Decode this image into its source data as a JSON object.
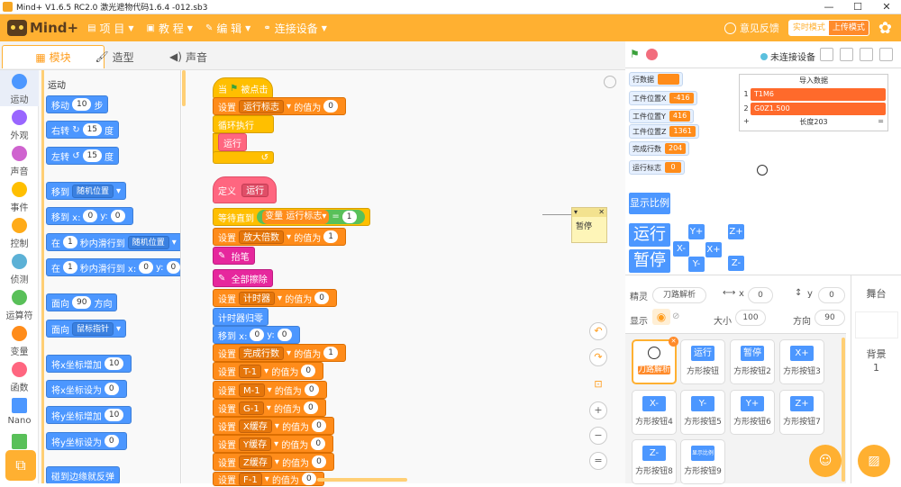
{
  "window": {
    "title": "Mind+ V1.6.5 RC2.0   激光遮物代码1.6.4 -012.sb3",
    "minimize": "—",
    "maximize": "☐",
    "close": "✕"
  },
  "menubar": {
    "logo_text": "Mind+",
    "menus": [
      "项 目",
      "教 程",
      "编 辑",
      "连接设备"
    ],
    "feedback": "意见反馈",
    "mode_realtime": "实时模式",
    "mode_upload": "上传模式"
  },
  "tabs": [
    "模块",
    "造型",
    "声音"
  ],
  "runbar": {
    "connection": "未连接设备"
  },
  "categories": [
    {
      "label": "运动",
      "color": "#4c97ff"
    },
    {
      "label": "外观",
      "color": "#9966ff"
    },
    {
      "label": "声音",
      "color": "#cf63cf"
    },
    {
      "label": "事件",
      "color": "#ffbf00"
    },
    {
      "label": "控制",
      "color": "#ffab19"
    },
    {
      "label": "侦测",
      "color": "#5cb1d6"
    },
    {
      "label": "运算符",
      "color": "#59c059"
    },
    {
      "label": "变量",
      "color": "#ff8c1a"
    },
    {
      "label": "函数",
      "color": "#ff6680"
    },
    {
      "label": "Nano",
      "color": "#4c97ff"
    },
    {
      "label": "",
      "color": "#59c059"
    }
  ],
  "palette": {
    "title": "运动",
    "blocks": {
      "move": {
        "a": "移动",
        "v": "10",
        "b": "步"
      },
      "turn_right": {
        "a": "右转",
        "icon": "↻",
        "v": "15",
        "b": "度"
      },
      "turn_left": {
        "a": "左转",
        "icon": "↺",
        "v": "15",
        "b": "度"
      },
      "goto": {
        "a": "移到",
        "dd": "随机位置"
      },
      "goto_xy": {
        "a": "移到 x:",
        "x": "0",
        "b": "y:",
        "y": "0"
      },
      "glide": {
        "a": "在",
        "v": "1",
        "b": "秒内滑行到",
        "dd": "随机位置"
      },
      "glide_xy": {
        "a": "在",
        "v": "1",
        "b": "秒内滑行到 x:",
        "x": "0",
        "c": "y:",
        "y": "0"
      },
      "point": {
        "a": "面向",
        "v": "90",
        "b": "方向"
      },
      "point_towards": {
        "a": "面向",
        "dd": "鼠标指针"
      },
      "change_x": {
        "a": "将x坐标增加",
        "v": "10"
      },
      "set_x": {
        "a": "将x坐标设为",
        "v": "0"
      },
      "change_y": {
        "a": "将y坐标增加",
        "v": "10"
      },
      "set_y": {
        "a": "将y坐标设为",
        "v": "0"
      },
      "bounce": {
        "a": "碰到边缘就反弹"
      }
    }
  },
  "script": {
    "hat_when": "当",
    "hat_clicked": "被点击",
    "set_label": "设置",
    "value_of": "的值为",
    "forever": "循环执行",
    "run_call": "运行",
    "define": "定义",
    "define_name": "运行",
    "wait_until": "等待直到",
    "var_word": "变量",
    "var_run_flag": "运行标志",
    "eq": "=",
    "eq_val": "1",
    "pen_up": "抬笔",
    "clear_all": "全部擦除",
    "reset_timer": "计时器归零",
    "goto_label": "移到 x:",
    "y_label": "y:",
    "rows": [
      {
        "var": "运行标志",
        "val": "0"
      },
      {
        "var": "放大倍数",
        "val": "1"
      },
      {
        "var": "计时器",
        "val": "0"
      },
      {
        "var": "完成行数",
        "val": "1"
      },
      {
        "var": "T-1",
        "val": "0"
      },
      {
        "var": "M-1",
        "val": "0"
      },
      {
        "var": "G-1",
        "val": "0"
      },
      {
        "var": "X缓存",
        "val": "0"
      },
      {
        "var": "Y缓存",
        "val": "0"
      },
      {
        "var": "Z缓存",
        "val": "0"
      },
      {
        "var": "F-1",
        "val": "0"
      }
    ],
    "goto_x": "0",
    "goto_y": "0",
    "note_text": "暂停"
  },
  "stage": {
    "monitors": [
      {
        "label": "行数据",
        "value": ""
      },
      {
        "label": "工件位置X",
        "value": "-416"
      },
      {
        "label": "工件位置Y",
        "value": "416"
      },
      {
        "label": "工件位置Z",
        "value": "1361"
      },
      {
        "label": "完成行数",
        "value": "204"
      },
      {
        "label": "运行标志",
        "value": "0"
      }
    ],
    "import_panel": {
      "title": "导入数据",
      "rows": [
        {
          "n": "1",
          "v": "T1M6"
        },
        {
          "n": "2",
          "v": "G0Z1.500"
        }
      ],
      "plus": "+",
      "length": "长度203",
      "eq": "="
    },
    "buttons": {
      "show_scale": "显示比例",
      "run": "运行",
      "pause": "暂停",
      "yplus": "Y+",
      "zplus": "Z+",
      "xminus": "X-",
      "xplus": "X+",
      "yminus": "Y-",
      "zminus": "Z-"
    }
  },
  "sprite_info": {
    "sprite_label": "精灵",
    "sprite_name": "刀路解析",
    "x_label": "x",
    "x": "0",
    "y_label": "y",
    "y": "0",
    "show_label": "显示",
    "size_label": "大小",
    "size": "100",
    "dir_label": "方向",
    "dir": "90"
  },
  "sprites": [
    {
      "name": "刀路解析",
      "thumb": ""
    },
    {
      "name": "方形按钮",
      "thumb": "运行"
    },
    {
      "name": "方形按钮2",
      "thumb": "暂停"
    },
    {
      "name": "方形按钮3",
      "thumb": "X+"
    },
    {
      "name": "方形按钮4",
      "thumb": "X-"
    },
    {
      "name": "方形按钮5",
      "thumb": "Y-"
    },
    {
      "name": "方形按钮6",
      "thumb": "Y+"
    },
    {
      "name": "方形按钮7",
      "thumb": "Z+"
    },
    {
      "name": "方形按钮8",
      "thumb": "Z-"
    },
    {
      "name": "方形按钮9",
      "thumb": "显示比例"
    }
  ],
  "stage_col": {
    "title": "舞台",
    "backdrop_label": "背景",
    "backdrop_count": "1"
  }
}
